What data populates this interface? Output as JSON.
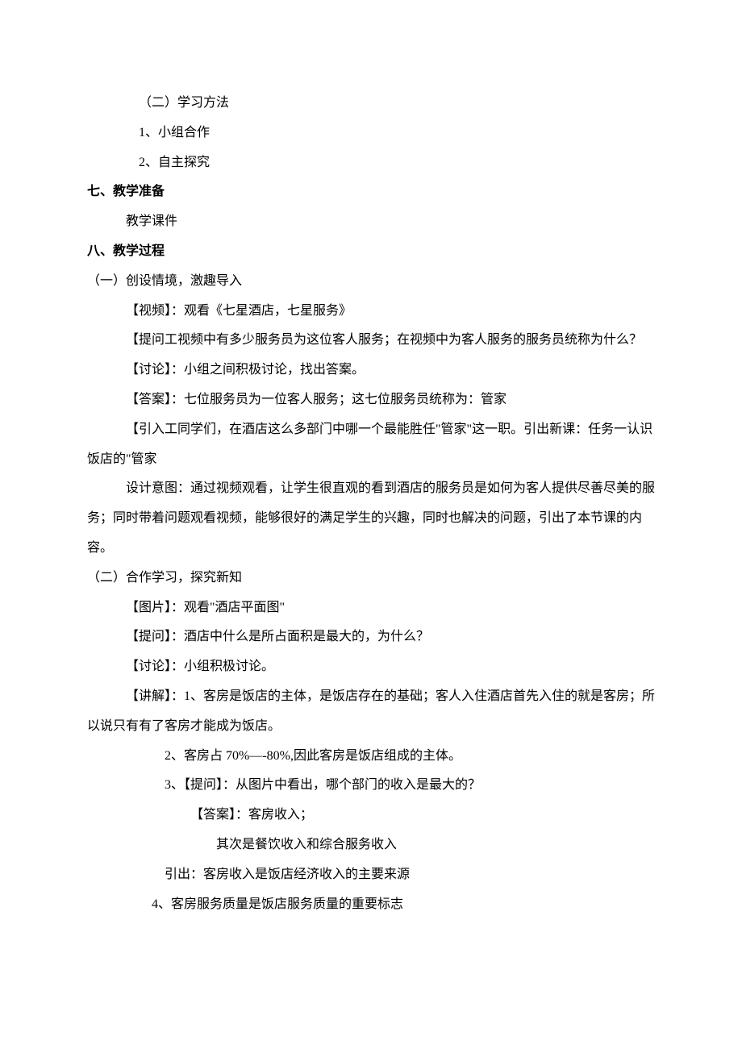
{
  "lines": {
    "l1": "（二）学习方法",
    "l2": "1、小组合作",
    "l3": "2、自主探究",
    "l4": "七、教学准备",
    "l5": "教学课件",
    "l6": "八、教学过程",
    "l7": "（一）创设情境，激趣导入",
    "l8": "【视频】：观看《七星酒店，七星服务》",
    "l9": "【提问工视频中有多少服务员为这位客人服务；在视频中为客人服务的服务员统称为什么？",
    "l10": "【讨论】：小组之间积极讨论，找出答案。",
    "l11": "【答案】：七位服务员为一位客人服务；这七位服务员统称为：管家",
    "l12": "【引入工同学们，在酒店这么多部门中哪一个最能胜任\"管家\"这一职。引出新课：任务一认识饭店的\"管家",
    "l13": "设计意图：通过视频观看，让学生很直观的看到酒店的服务员是如何为客人提供尽善尽美的服务；同时带着问题观看视频，能够很好的满足学生的兴趣，同时也解决的问题，引出了本节课的内容。",
    "l14": "（二）合作学习，探究新知",
    "l15": "【图片】：观看\"酒店平面图\"",
    "l16": "【提问】：酒店中什么是所占面积是最大的，为什么？",
    "l17": "【讨论】：小组积极讨论。",
    "l18": "【讲解】：1、客房是饭店的主体，是饭店存在的基础；客人入住酒店首先入住的就是客房；所以说只有有了客房才能成为饭店。",
    "l19": "2、客房占 70%—-80%,因此客房是饭店组成的主体。",
    "l20": "3、【提问】：从图片中看出，哪个部门的收入是最大的？",
    "l21": "【答案】：客房收入；",
    "l22": "其次是餐饮收入和综合服务收入",
    "l23": "引出：客房收入是饭店经济收入的主要来源",
    "l24": "4、客房服务质量是饭店服务质量的重要标志"
  }
}
